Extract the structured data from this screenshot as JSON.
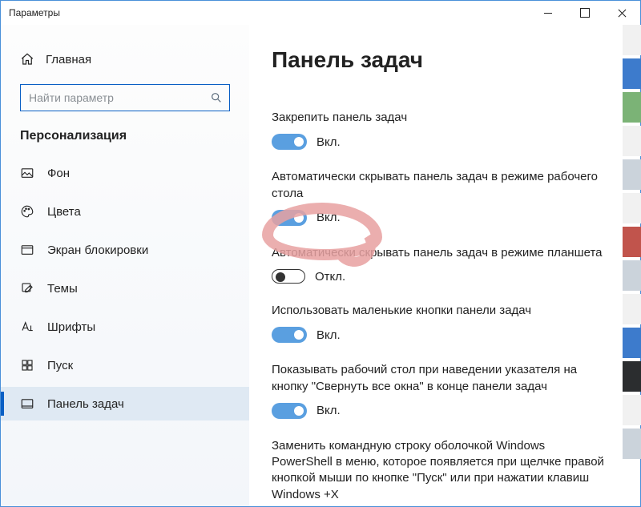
{
  "titlebar": {
    "title": "Параметры"
  },
  "sidebar": {
    "home": "Главная",
    "search_placeholder": "Найти параметр",
    "section": "Персонализация",
    "items": [
      {
        "label": "Фон"
      },
      {
        "label": "Цвета"
      },
      {
        "label": "Экран блокировки"
      },
      {
        "label": "Темы"
      },
      {
        "label": "Шрифты"
      },
      {
        "label": "Пуск"
      },
      {
        "label": "Панель задач"
      }
    ]
  },
  "content": {
    "title": "Панель задач",
    "on": "Вкл.",
    "off": "Откл.",
    "settings": [
      {
        "label": "Закрепить панель задач",
        "state": "on"
      },
      {
        "label": "Автоматически скрывать панель задач в режиме рабочего стола",
        "state": "on"
      },
      {
        "label": "Автоматически скрывать панель задач в режиме планшета",
        "state": "off"
      },
      {
        "label": "Использовать маленькие кнопки панели задач",
        "state": "on"
      },
      {
        "label": "Показывать рабочий стол при наведении указателя на кнопку \"Свернуть все окна\" в конце панели задач",
        "state": "on"
      },
      {
        "label": "Заменить командную строку оболочкой Windows PowerShell в меню, которое появляется при щелчке правой кнопкой мыши по кнопке \"Пуск\" или при нажатии клавиш Windows +X",
        "state": null
      }
    ]
  }
}
